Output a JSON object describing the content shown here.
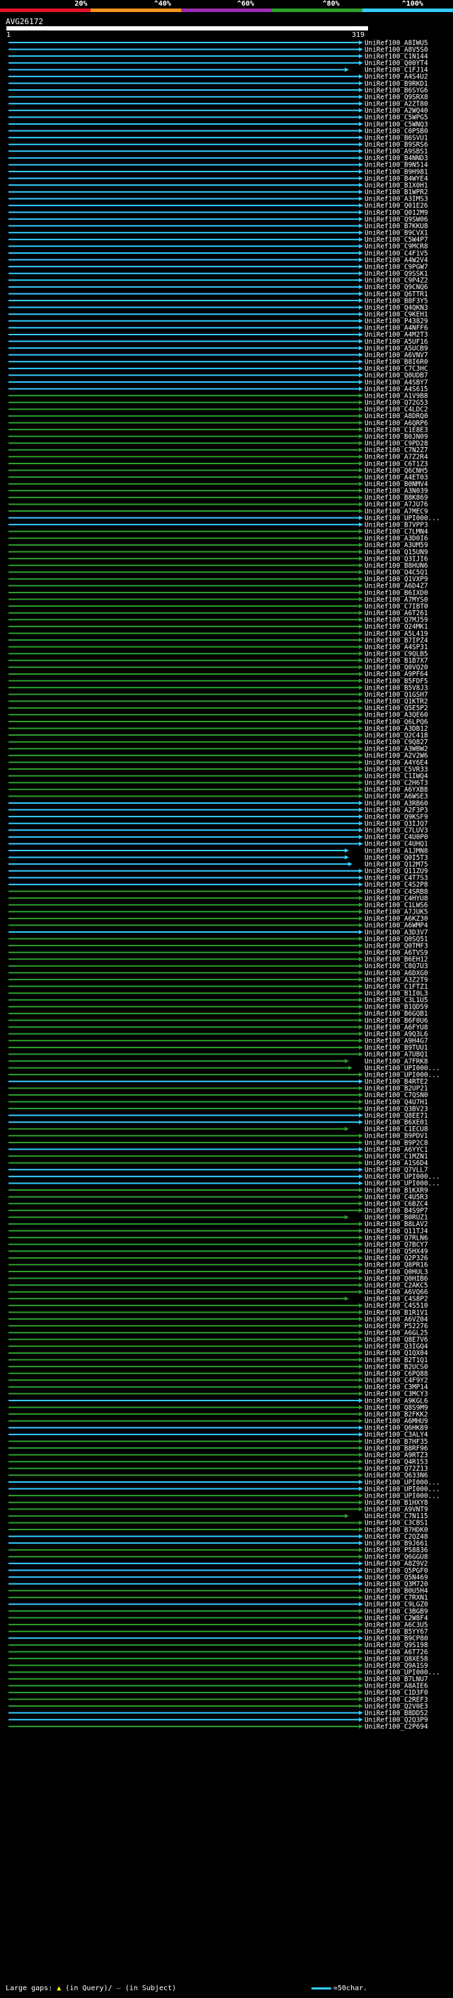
{
  "scale": {
    "ticks": [
      "20%",
      "^40%",
      "^60%",
      "^80%",
      "^100%"
    ],
    "colors": [
      "#e8142a",
      "#f7941e",
      "#9c2fb2",
      "#2ca02c",
      "#33ccff"
    ]
  },
  "query": {
    "id": "AVG26172",
    "start": "1",
    "end": "319"
  },
  "colors": {
    "cyan": "#33ccff",
    "green": "#2ca02c",
    "gap": "#ffff00"
  },
  "hits": [
    "UniRef100_A8IWU5",
    "UniRef100_A8V5S0",
    "UniRef100_C1N144",
    "UniRef100_Q00YT4",
    "UniRef100_C1FJ14",
    "UniRef100_A4S4U2",
    "UniRef100_B9RKD1",
    "UniRef100_B6SYG6",
    "UniRef100_Q9SRX8",
    "UniRef100_A2ZT80",
    "UniRef100_A2WQ40",
    "UniRef100_C5WPG5",
    "UniRef100_C5WNQ3",
    "UniRef100_C0P5B0",
    "UniRef100_B6SVU1",
    "UniRef100_B9SRS6",
    "UniRef100_A9SBS1",
    "UniRef100_B4NND3",
    "UniRef100_B9N514",
    "UniRef100_B9H981",
    "UniRef100_B4WYE4",
    "UniRef100_B1X0H1",
    "UniRef100_B1WPR2",
    "UniRef100_A3IMS3",
    "UniRef100_Q01E26",
    "UniRef100_Q012M9",
    "UniRef100_Q9SW06",
    "UniRef100_B7KKU8",
    "UniRef100_B9CVX1",
    "UniRef100_C5W4P7",
    "UniRef100_C9MCR8",
    "UniRef100_C4F1V5",
    "UniRef100_A4W2V4",
    "UniRef100_C9PGW7",
    "UniRef100_Q9SSK1",
    "UniRef100_C9P4Z2",
    "UniRef100_Q9CNQ6",
    "UniRef100_Q6TTR1",
    "UniRef100_B8F3Y5",
    "UniRef100_Q4QKN3",
    "UniRef100_C9KEH1",
    "UniRef100_P43829",
    "UniRef100_A4NFF6",
    "UniRef100_A4M2T3",
    "UniRef100_A5UF16",
    "UniRef100_A5UCB9",
    "UniRef100_A6VNV7",
    "UniRef100_B8I6R0",
    "UniRef100_C7C3HC",
    "UniRef100_Q0UDB7",
    "UniRef100_A4SBY7",
    "UniRef100_A4S615",
    "UniRef100_A1V9B8",
    "UniRef100_Q72G53",
    "UniRef100_C4LDC2",
    "UniRef100_A8DRQ0",
    "UniRef100_A6QRP6",
    "UniRef100_C1E8E3",
    "UniRef100_B0JN09",
    "UniRef100_C9PD28",
    "UniRef100_C7N2Z7",
    "UniRef100_A7Z2R4",
    "UniRef100_C6T1Z3",
    "UniRef100_Q6CNH5",
    "UniRef100_A4ET03",
    "UniRef100_B0NMV4",
    "UniRef100_A3N039",
    "UniRef100_B8K869",
    "UniRef100_A7JU76",
    "UniRef100_A7MEC9",
    "UniRef100_UPI000...",
    "UniRef100_B7VPP3",
    "UniRef100_C7LMN4",
    "UniRef100_A3D0I6",
    "UniRef100_A3UM59",
    "UniRef100_Q15UN9",
    "UniRef100_Q3IJI6",
    "UniRef100_B8HUN6",
    "UniRef100_Q4C5Q1",
    "UniRef100_Q1VXP9",
    "UniRef100_A6D4Z7",
    "UniRef100_B6IXD0",
    "UniRef100_A7MYS0",
    "UniRef100_C7IBT0",
    "UniRef100_A6T261",
    "UniRef100_Q7MJ59",
    "UniRef100_Q24MK1",
    "UniRef100_A5L419",
    "UniRef100_B7IPZ4",
    "UniRef100_A4SP31",
    "UniRef100_C9QLB5",
    "UniRef100_B1B7X7",
    "UniRef100_Q0VQ20",
    "UniRef100_A9PF64",
    "UniRef100_B5FDF5",
    "UniRef100_B5V8J3",
    "UniRef100_Q1GSH7",
    "UniRef100_Q1KTR2",
    "UniRef100_Q5E5P2",
    "UniRef100_A3QE60",
    "UniRef100_Q6LPQ6",
    "UniRef100_A3DB12",
    "UniRef100_Q2C418",
    "UniRef100_C9Q827",
    "UniRef100_A3WBW2",
    "UniRef100_A2V2W6",
    "UniRef100_A4Y6E4",
    "UniRef100_C5VR33",
    "UniRef100_C1IWQ4",
    "UniRef100_C2H6T3",
    "UniRef100_A6YXB8",
    "UniRef100_A6WSE3",
    "UniRef100_A3RB60",
    "UniRef100_A2F3P3",
    "UniRef100_Q9KSF9",
    "UniRef100_Q3IJQ7",
    "UniRef100_C7LUV3",
    "UniRef100_C4U0P0",
    "UniRef100_C4UHQ1",
    "UniRef100_A1JMN8",
    "UniRef100_Q0I5T3",
    "UniRef100_Q12M75",
    "UniRef100_Q11ZU9",
    "UniRef100_C4T7S3",
    "UniRef100_C4S2P8",
    "UniRef100_C4SRB8",
    "UniRef100_C4HYU8",
    "UniRef100_C1LWS6",
    "UniRef100_A7JUK5",
    "UniRef100_A6KZ30",
    "UniRef100_A6WMP4",
    "UniRef100_A3D3V7",
    "UniRef100_Q0SQ51",
    "UniRef100_Q0TMF3",
    "UniRef100_A6TVS9",
    "UniRef100_B6EH12",
    "UniRef100_C8Q7U3",
    "UniRef100_A6DXG0",
    "UniRef100_A3Z2T9",
    "UniRef100_C1FTZ1",
    "UniRef100_B1I0L3",
    "UniRef100_C3L1U5",
    "UniRef100_B1QD59",
    "UniRef100_B6GQB1",
    "UniRef100_B6F0U6",
    "UniRef100_A6FYU8",
    "UniRef100_A9Q3L6",
    "UniRef100_A9H4G7",
    "UniRef100_B9TUU1",
    "UniRef100_A7UBQ1",
    "UniRef100_A7FRK8",
    "UniRef100_UPI000...",
    "UniRef100_UPI000...",
    "UniRef100_B4RTE2",
    "UniRef100_B2UP21",
    "UniRef100_C7QSN0",
    "UniRef100_Q4U7H1",
    "UniRef100_Q3BV23",
    "UniRef100_Q8EE71",
    "UniRef100_B6XE01",
    "UniRef100_C1ECU8",
    "UniRef100_B9PDV1",
    "UniRef100_B9P2C8",
    "UniRef100_A6YYC1",
    "UniRef100_C1MZN1",
    "UniRef100_A1S6D4",
    "UniRef100_Q7VLL7",
    "UniRef100_UPI000...",
    "UniRef100_UPI000...",
    "UniRef100_B1KXR9",
    "UniRef100_C4U5R3",
    "UniRef100_C6BZC4",
    "UniRef100_B4S9P7",
    "UniRef100_B0RUZ1",
    "UniRef100_B8LAV2",
    "UniRef100_Q11TJ4",
    "UniRef100_Q7RLN6",
    "UniRef100_Q7BCY7",
    "UniRef100_Q5HX49",
    "UniRef100_Q2P326",
    "UniRef100_Q8PR16",
    "UniRef100_Q0HUL3",
    "UniRef100_Q0HIB6",
    "UniRef100_C2AKC5",
    "UniRef100_A6VQ66",
    "UniRef100_C4S8P2",
    "UniRef100_C4S510",
    "UniRef100_B1R1V1",
    "UniRef100_A6VZ04",
    "UniRef100_P52276",
    "UniRef100_A6GL25",
    "UniRef100_Q8E7V6",
    "UniRef100_Q3IGQ4",
    "UniRef100_Q1QX04",
    "UniRef100_B2T1Q1",
    "UniRef100_B2UCS0",
    "UniRef100_C6PQ88",
    "UniRef100_C4F9Y2",
    "UniRef100_C3MP14",
    "UniRef100_C3MCY3",
    "UniRef100_A9KGL6",
    "UniRef100_Q8S9M9",
    "UniRef100_B2FKK2",
    "UniRef100_A6MHU9",
    "UniRef100_Q6HK89",
    "UniRef100_C3ALY4",
    "UniRef100_B7HF35",
    "UniRef100_B8RF96",
    "UniRef100_A9RTZ3",
    "UniRef100_Q4R153",
    "UniRef100_Q72Z13",
    "UniRef100_Q633N6",
    "UniRef100_UPI000...",
    "UniRef100_UPI000...",
    "UniRef100_UPI000...",
    "UniRef100_B1HXY8",
    "UniRef100_A9VNT9",
    "UniRef100_C7N115",
    "UniRef100_C3CBS1",
    "UniRef100_B7HDK0",
    "UniRef100_C2QZ48",
    "UniRef100_B9J661",
    "UniRef100_P58836",
    "UniRef100_Q6GGU8",
    "UniRef100_A8Z9V2",
    "UniRef100_Q5PGF0",
    "UniRef100_Q5N469",
    "UniRef100_Q3M720",
    "UniRef100_B0U5H4",
    "UniRef100_C7RXN1",
    "UniRef100_C9LGZ0",
    "UniRef100_C3BGB9",
    "UniRef100_C2W8F4",
    "UniRef100_A6C3U5",
    "UniRef100_B5YY67",
    "UniRef100_B9CP80",
    "UniRef100_Q9S198",
    "UniRef100_A6T726",
    "UniRef100_Q8XE58",
    "UniRef100_Q9A1S9",
    "UniRef100_UPI000...",
    "UniRef100_B7LNU7",
    "UniRef100_A8AIE6",
    "UniRef100_C1D3F0",
    "UniRef100_C2REF3",
    "UniRef100_Q2V0E3",
    "UniRef100_B8DD52",
    "UniRef100_Q2Q3P9",
    "UniRef100_C2P694"
  ],
  "footer": {
    "gaps_label": "Large gaps:",
    "gaps_query": "(in Query)",
    "gaps_subject": "(in Subject)",
    "legend": "=50char."
  }
}
